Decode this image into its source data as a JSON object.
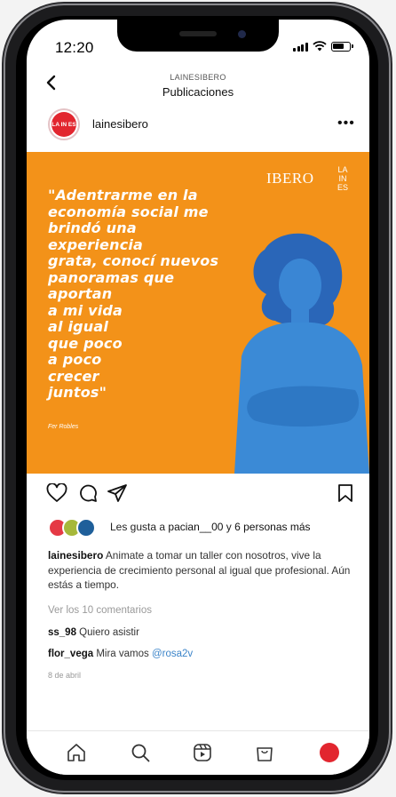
{
  "status": {
    "time": "12:20"
  },
  "nav": {
    "subtitle": "LAINESIBERO",
    "title": "Publicaciones"
  },
  "profile": {
    "username": "lainesibero",
    "avatar_text": "LA IN ES"
  },
  "post": {
    "quote_lines": [
      "\"Adentrarme en la",
      "economía social me",
      "brindó una experiencia",
      "grata, conocí nuevos",
      "panoramas que",
      "aportan",
      "a mi vida",
      "al igual",
      "que poco",
      "a poco",
      "crecer",
      "juntos\""
    ],
    "quote_author": "Fer Robles",
    "brand_ibero": "IBERO",
    "brand_lines": [
      "LA",
      "IN",
      "ES"
    ],
    "background_color": "#f39219",
    "person_color": "#2f7fd0"
  },
  "likes": {
    "prefix": "Les gusta a ",
    "user": "pacian__00",
    "middle": " y ",
    "others": "6 personas más",
    "avatar_colors": [
      "#e53945",
      "#a6b83a",
      "#1f5f9a"
    ]
  },
  "caption": {
    "username": "lainesibero",
    "text": " Animate a tomar un taller con nosotros, vive la experiencia de crecimiento personal al igual que profesional. Aún estás a tiempo."
  },
  "comments": {
    "view_all": "Ver los 10 comentarios",
    "items": [
      {
        "user": "ss_98",
        "text": " Quiero asistir",
        "mention": ""
      },
      {
        "user": "flor_vega",
        "text": " Mira vamos ",
        "mention": "@rosa2v"
      }
    ]
  },
  "date": "8 de abril",
  "tabbar": {
    "items": [
      "home-icon",
      "search-icon",
      "reels-icon",
      "shop-icon",
      "profile-avatar"
    ]
  }
}
